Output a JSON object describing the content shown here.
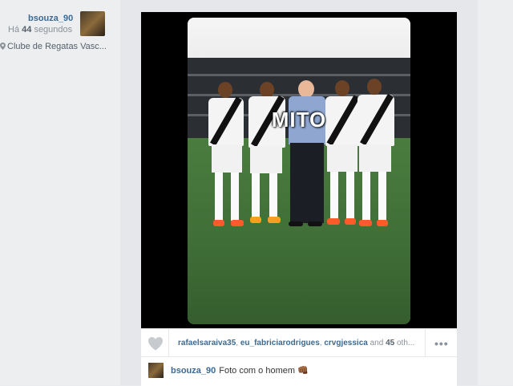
{
  "post": {
    "username": "bsouza_90",
    "time_prefix": "Há",
    "time_value": "44",
    "time_suffix": "segundos",
    "location": "Clube de Regatas Vasc..."
  },
  "photo": {
    "overlay_text": "MITO"
  },
  "likes": {
    "users": [
      "rafaelsaraiva35",
      "eu_fabriciarodrigues",
      "crvgjessica"
    ],
    "sep": ", ",
    "and_text": " and ",
    "others_count": "45",
    "others_text": " oth..."
  },
  "comment": {
    "username": "bsouza_90",
    "text": "Foto com o homem 👊🏾"
  },
  "colors": {
    "link": "#3c6a93",
    "muted": "#8a9199"
  },
  "icons": {
    "location": "map-pin-icon",
    "like": "heart-icon",
    "more": "more-options-icon"
  }
}
